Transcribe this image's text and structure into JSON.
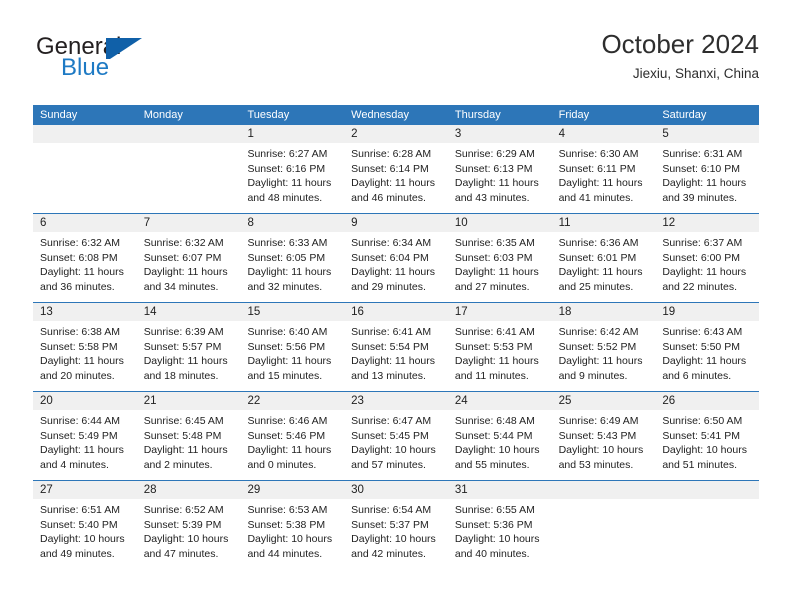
{
  "brand": {
    "word_general": "General",
    "word_blue": "Blue",
    "flag_color": "#1060a8",
    "blue_text_color": "#1e7ac4"
  },
  "header": {
    "title": "October 2024",
    "subtitle": "Jiexiu, Shanxi, China"
  },
  "theme": {
    "header_blue": "#2d76b8",
    "row_divider": "#2d76b8",
    "date_band_gray": "#f0f0f0"
  },
  "calendar": {
    "weekday_headers": [
      "Sunday",
      "Monday",
      "Tuesday",
      "Wednesday",
      "Thursday",
      "Friday",
      "Saturday"
    ],
    "weeks": [
      [
        {
          "day": "",
          "sunrise": "",
          "sunset": "",
          "daylight1": "",
          "daylight2": ""
        },
        {
          "day": "",
          "sunrise": "",
          "sunset": "",
          "daylight1": "",
          "daylight2": ""
        },
        {
          "day": "1",
          "sunrise": "Sunrise: 6:27 AM",
          "sunset": "Sunset: 6:16 PM",
          "daylight1": "Daylight: 11 hours",
          "daylight2": "and 48 minutes."
        },
        {
          "day": "2",
          "sunrise": "Sunrise: 6:28 AM",
          "sunset": "Sunset: 6:14 PM",
          "daylight1": "Daylight: 11 hours",
          "daylight2": "and 46 minutes."
        },
        {
          "day": "3",
          "sunrise": "Sunrise: 6:29 AM",
          "sunset": "Sunset: 6:13 PM",
          "daylight1": "Daylight: 11 hours",
          "daylight2": "and 43 minutes."
        },
        {
          "day": "4",
          "sunrise": "Sunrise: 6:30 AM",
          "sunset": "Sunset: 6:11 PM",
          "daylight1": "Daylight: 11 hours",
          "daylight2": "and 41 minutes."
        },
        {
          "day": "5",
          "sunrise": "Sunrise: 6:31 AM",
          "sunset": "Sunset: 6:10 PM",
          "daylight1": "Daylight: 11 hours",
          "daylight2": "and 39 minutes."
        }
      ],
      [
        {
          "day": "6",
          "sunrise": "Sunrise: 6:32 AM",
          "sunset": "Sunset: 6:08 PM",
          "daylight1": "Daylight: 11 hours",
          "daylight2": "and 36 minutes."
        },
        {
          "day": "7",
          "sunrise": "Sunrise: 6:32 AM",
          "sunset": "Sunset: 6:07 PM",
          "daylight1": "Daylight: 11 hours",
          "daylight2": "and 34 minutes."
        },
        {
          "day": "8",
          "sunrise": "Sunrise: 6:33 AM",
          "sunset": "Sunset: 6:05 PM",
          "daylight1": "Daylight: 11 hours",
          "daylight2": "and 32 minutes."
        },
        {
          "day": "9",
          "sunrise": "Sunrise: 6:34 AM",
          "sunset": "Sunset: 6:04 PM",
          "daylight1": "Daylight: 11 hours",
          "daylight2": "and 29 minutes."
        },
        {
          "day": "10",
          "sunrise": "Sunrise: 6:35 AM",
          "sunset": "Sunset: 6:03 PM",
          "daylight1": "Daylight: 11 hours",
          "daylight2": "and 27 minutes."
        },
        {
          "day": "11",
          "sunrise": "Sunrise: 6:36 AM",
          "sunset": "Sunset: 6:01 PM",
          "daylight1": "Daylight: 11 hours",
          "daylight2": "and 25 minutes."
        },
        {
          "day": "12",
          "sunrise": "Sunrise: 6:37 AM",
          "sunset": "Sunset: 6:00 PM",
          "daylight1": "Daylight: 11 hours",
          "daylight2": "and 22 minutes."
        }
      ],
      [
        {
          "day": "13",
          "sunrise": "Sunrise: 6:38 AM",
          "sunset": "Sunset: 5:58 PM",
          "daylight1": "Daylight: 11 hours",
          "daylight2": "and 20 minutes."
        },
        {
          "day": "14",
          "sunrise": "Sunrise: 6:39 AM",
          "sunset": "Sunset: 5:57 PM",
          "daylight1": "Daylight: 11 hours",
          "daylight2": "and 18 minutes."
        },
        {
          "day": "15",
          "sunrise": "Sunrise: 6:40 AM",
          "sunset": "Sunset: 5:56 PM",
          "daylight1": "Daylight: 11 hours",
          "daylight2": "and 15 minutes."
        },
        {
          "day": "16",
          "sunrise": "Sunrise: 6:41 AM",
          "sunset": "Sunset: 5:54 PM",
          "daylight1": "Daylight: 11 hours",
          "daylight2": "and 13 minutes."
        },
        {
          "day": "17",
          "sunrise": "Sunrise: 6:41 AM",
          "sunset": "Sunset: 5:53 PM",
          "daylight1": "Daylight: 11 hours",
          "daylight2": "and 11 minutes."
        },
        {
          "day": "18",
          "sunrise": "Sunrise: 6:42 AM",
          "sunset": "Sunset: 5:52 PM",
          "daylight1": "Daylight: 11 hours",
          "daylight2": "and 9 minutes."
        },
        {
          "day": "19",
          "sunrise": "Sunrise: 6:43 AM",
          "sunset": "Sunset: 5:50 PM",
          "daylight1": "Daylight: 11 hours",
          "daylight2": "and 6 minutes."
        }
      ],
      [
        {
          "day": "20",
          "sunrise": "Sunrise: 6:44 AM",
          "sunset": "Sunset: 5:49 PM",
          "daylight1": "Daylight: 11 hours",
          "daylight2": "and 4 minutes."
        },
        {
          "day": "21",
          "sunrise": "Sunrise: 6:45 AM",
          "sunset": "Sunset: 5:48 PM",
          "daylight1": "Daylight: 11 hours",
          "daylight2": "and 2 minutes."
        },
        {
          "day": "22",
          "sunrise": "Sunrise: 6:46 AM",
          "sunset": "Sunset: 5:46 PM",
          "daylight1": "Daylight: 11 hours",
          "daylight2": "and 0 minutes."
        },
        {
          "day": "23",
          "sunrise": "Sunrise: 6:47 AM",
          "sunset": "Sunset: 5:45 PM",
          "daylight1": "Daylight: 10 hours",
          "daylight2": "and 57 minutes."
        },
        {
          "day": "24",
          "sunrise": "Sunrise: 6:48 AM",
          "sunset": "Sunset: 5:44 PM",
          "daylight1": "Daylight: 10 hours",
          "daylight2": "and 55 minutes."
        },
        {
          "day": "25",
          "sunrise": "Sunrise: 6:49 AM",
          "sunset": "Sunset: 5:43 PM",
          "daylight1": "Daylight: 10 hours",
          "daylight2": "and 53 minutes."
        },
        {
          "day": "26",
          "sunrise": "Sunrise: 6:50 AM",
          "sunset": "Sunset: 5:41 PM",
          "daylight1": "Daylight: 10 hours",
          "daylight2": "and 51 minutes."
        }
      ],
      [
        {
          "day": "27",
          "sunrise": "Sunrise: 6:51 AM",
          "sunset": "Sunset: 5:40 PM",
          "daylight1": "Daylight: 10 hours",
          "daylight2": "and 49 minutes."
        },
        {
          "day": "28",
          "sunrise": "Sunrise: 6:52 AM",
          "sunset": "Sunset: 5:39 PM",
          "daylight1": "Daylight: 10 hours",
          "daylight2": "and 47 minutes."
        },
        {
          "day": "29",
          "sunrise": "Sunrise: 6:53 AM",
          "sunset": "Sunset: 5:38 PM",
          "daylight1": "Daylight: 10 hours",
          "daylight2": "and 44 minutes."
        },
        {
          "day": "30",
          "sunrise": "Sunrise: 6:54 AM",
          "sunset": "Sunset: 5:37 PM",
          "daylight1": "Daylight: 10 hours",
          "daylight2": "and 42 minutes."
        },
        {
          "day": "31",
          "sunrise": "Sunrise: 6:55 AM",
          "sunset": "Sunset: 5:36 PM",
          "daylight1": "Daylight: 10 hours",
          "daylight2": "and 40 minutes."
        },
        {
          "day": "",
          "sunrise": "",
          "sunset": "",
          "daylight1": "",
          "daylight2": ""
        },
        {
          "day": "",
          "sunrise": "",
          "sunset": "",
          "daylight1": "",
          "daylight2": ""
        }
      ]
    ]
  }
}
